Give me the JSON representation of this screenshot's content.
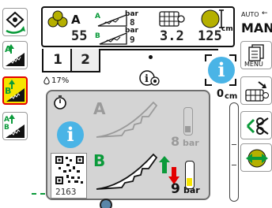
{
  "header": {
    "left_count": "55",
    "pressure_top_unit": "bar",
    "pressure_top_value": "8",
    "pressure_bottom_unit": "bar",
    "pressure_bottom_value": "9",
    "grid_value": "3.2",
    "bale_value": "125",
    "bale_unit": "cm",
    "label_a": "A",
    "label_b": "B"
  },
  "tabs": [
    {
      "label": "1"
    },
    {
      "label": "2"
    }
  ],
  "status": {
    "percent": "17%",
    "level_value": "0",
    "level_unit": "cm"
  },
  "right": {
    "auto_label": "AUTO",
    "mode_label": "MAN",
    "menu_label": "MENU"
  },
  "popup": {
    "blade_a_label": "A",
    "blade_b_label": "B",
    "pressure_a_value": "8",
    "pressure_a_unit": "bar",
    "pressure_b_value": "9",
    "pressure_b_unit": "bar",
    "qr_code_number": "2163"
  },
  "colors": {
    "accent_green": "#0a9a3a",
    "selected_bg": "#f6e400",
    "selected_border": "#e30000",
    "info_blue": "#4ab4e6",
    "popup_bg": "#d4d4d4"
  }
}
